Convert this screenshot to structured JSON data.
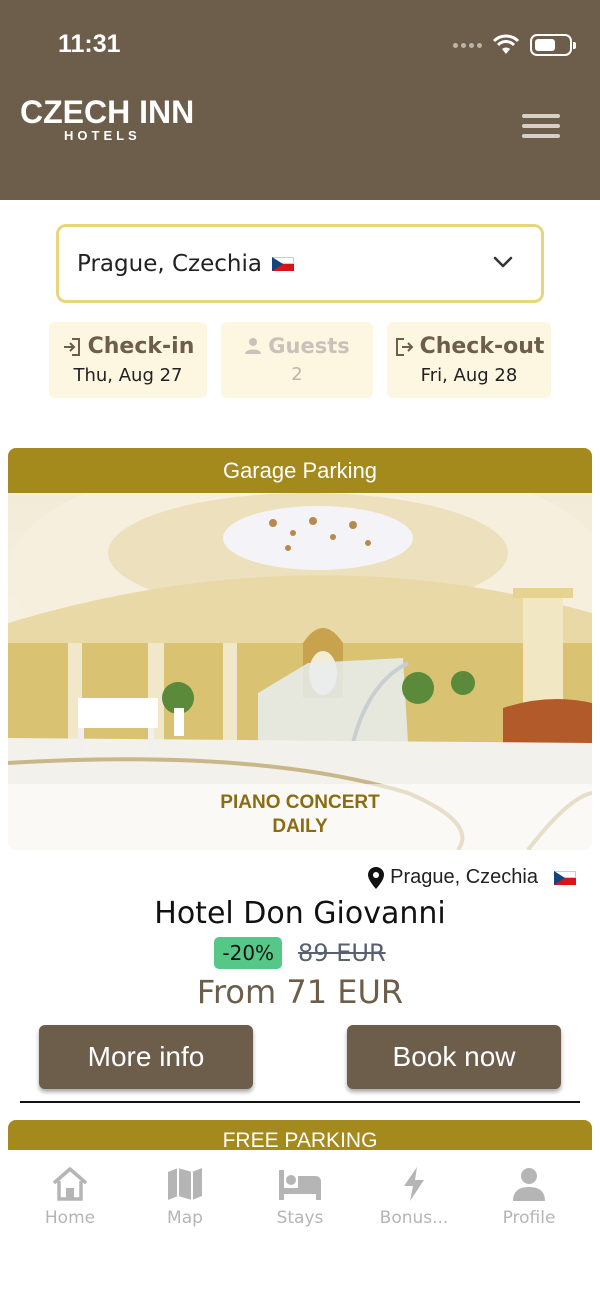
{
  "status_bar": {
    "time": "11:31"
  },
  "brand": {
    "main": "CZECH INN",
    "sub": "HOTELS"
  },
  "search": {
    "location": "Prague, Czechia"
  },
  "booking": {
    "checkin": {
      "label": "Check-in",
      "value": "Thu, Aug 27"
    },
    "guests": {
      "label": "Guests",
      "value": "2"
    },
    "checkout": {
      "label": "Check-out",
      "value": "Fri, Aug 28"
    }
  },
  "hotel": {
    "banner": "Garage Parking",
    "photo_caption_1": "PIANO CONCERT",
    "photo_caption_2": "DAILY",
    "location": "Prague, Czechia",
    "name": "Hotel Don Giovanni",
    "discount": "-20%",
    "old_price": "89 EUR",
    "from_price": "From 71 EUR",
    "more_info": "More info",
    "book_now": "Book now"
  },
  "next_hotel": {
    "banner": "FREE PARKING"
  },
  "tabs": [
    {
      "label": "Home",
      "icon": "home-icon"
    },
    {
      "label": "Map",
      "icon": "map-icon"
    },
    {
      "label": "Stays",
      "icon": "bed-icon"
    },
    {
      "label": "Bonus...",
      "icon": "lightning-icon"
    },
    {
      "label": "Profile",
      "icon": "person-icon"
    }
  ],
  "colors": {
    "brand": "#6d5d4b",
    "gold": "#a48a1d",
    "accent_border": "#e8d57c",
    "discount": "#57c788"
  }
}
